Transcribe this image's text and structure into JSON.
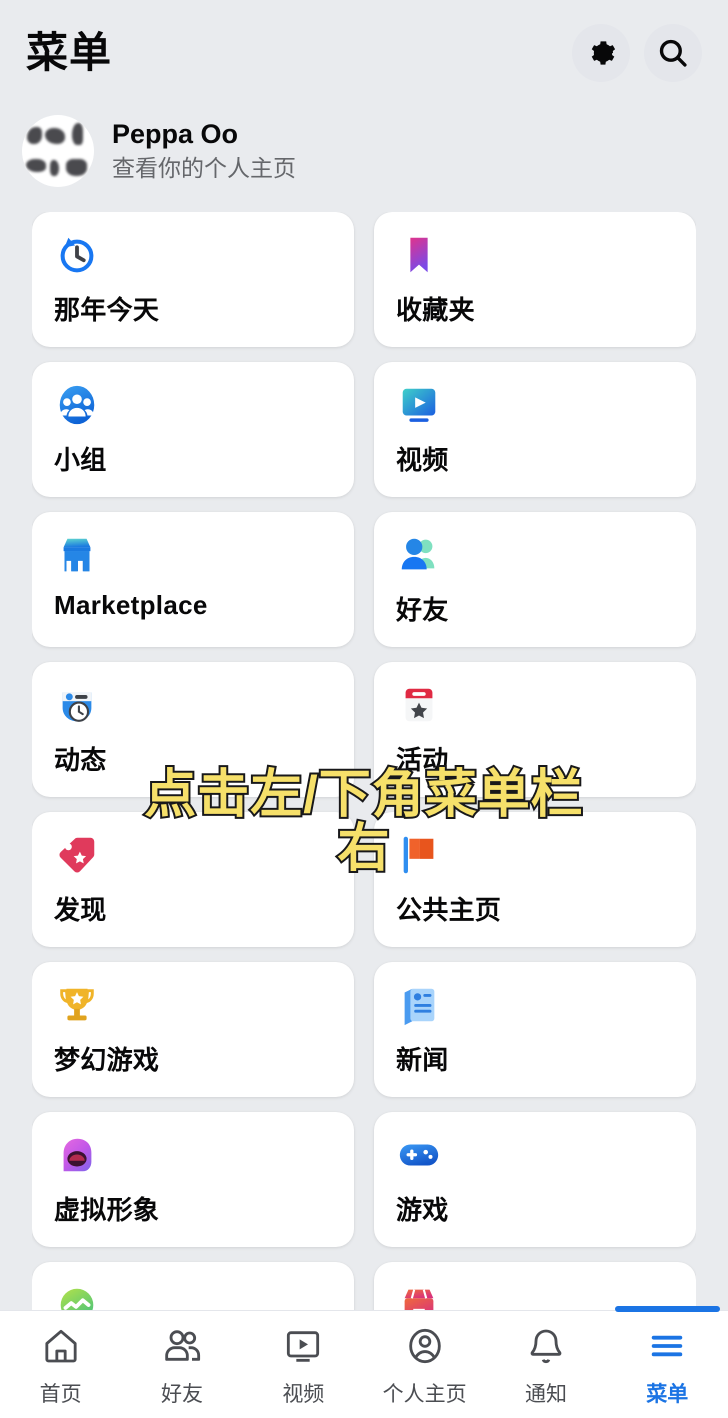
{
  "header": {
    "title": "菜单",
    "settings_icon": "gear-icon",
    "search_icon": "search-icon"
  },
  "profile": {
    "name": "Peppa Oo",
    "subtitle": "查看你的个人主页",
    "avatar_icon": "avatar"
  },
  "menu_grid": {
    "items": [
      {
        "label": "那年今天",
        "icon": "memories-clock-icon"
      },
      {
        "label": "收藏夹",
        "icon": "bookmark-icon"
      },
      {
        "label": "小组",
        "icon": "groups-icon"
      },
      {
        "label": "视频",
        "icon": "video-play-icon"
      },
      {
        "label": "Marketplace",
        "icon": "storefront-icon"
      },
      {
        "label": "好友",
        "icon": "friends-icon"
      },
      {
        "label": "动态",
        "icon": "feeds-clock-icon"
      },
      {
        "label": "活动",
        "icon": "events-calendar-star-icon"
      },
      {
        "label": "发现",
        "icon": "discover-tag-icon"
      },
      {
        "label": "公共主页",
        "icon": "pages-flag-icon"
      },
      {
        "label": "梦幻游戏",
        "icon": "trophy-icon"
      },
      {
        "label": "新闻",
        "icon": "news-icon"
      },
      {
        "label": "虚拟形象",
        "icon": "avatar-face-icon"
      },
      {
        "label": "游戏",
        "icon": "gamepad-icon"
      },
      {
        "label": "",
        "icon": "fundraiser-icon"
      },
      {
        "label": "",
        "icon": "orders-shop-icon"
      }
    ]
  },
  "caption": {
    "line1": "点击左/下角菜单栏",
    "line2": "右"
  },
  "bottom_nav": {
    "items": [
      {
        "label": "首页",
        "icon": "home-icon",
        "active": false
      },
      {
        "label": "好友",
        "icon": "friends-icon",
        "active": false
      },
      {
        "label": "视频",
        "icon": "video-icon",
        "active": false
      },
      {
        "label": "个人主页",
        "icon": "profile-icon",
        "active": false
      },
      {
        "label": "通知",
        "icon": "bell-icon",
        "active": false
      },
      {
        "label": "菜单",
        "icon": "hamburger-menu-icon",
        "active": true
      }
    ]
  },
  "colors": {
    "accent": "#1b74e4",
    "background": "#e9ebee",
    "card": "#ffffff",
    "text_primary": "#080809",
    "text_secondary": "#65676b",
    "caption_fill": "#f6e06a",
    "caption_stroke": "#18181a"
  }
}
